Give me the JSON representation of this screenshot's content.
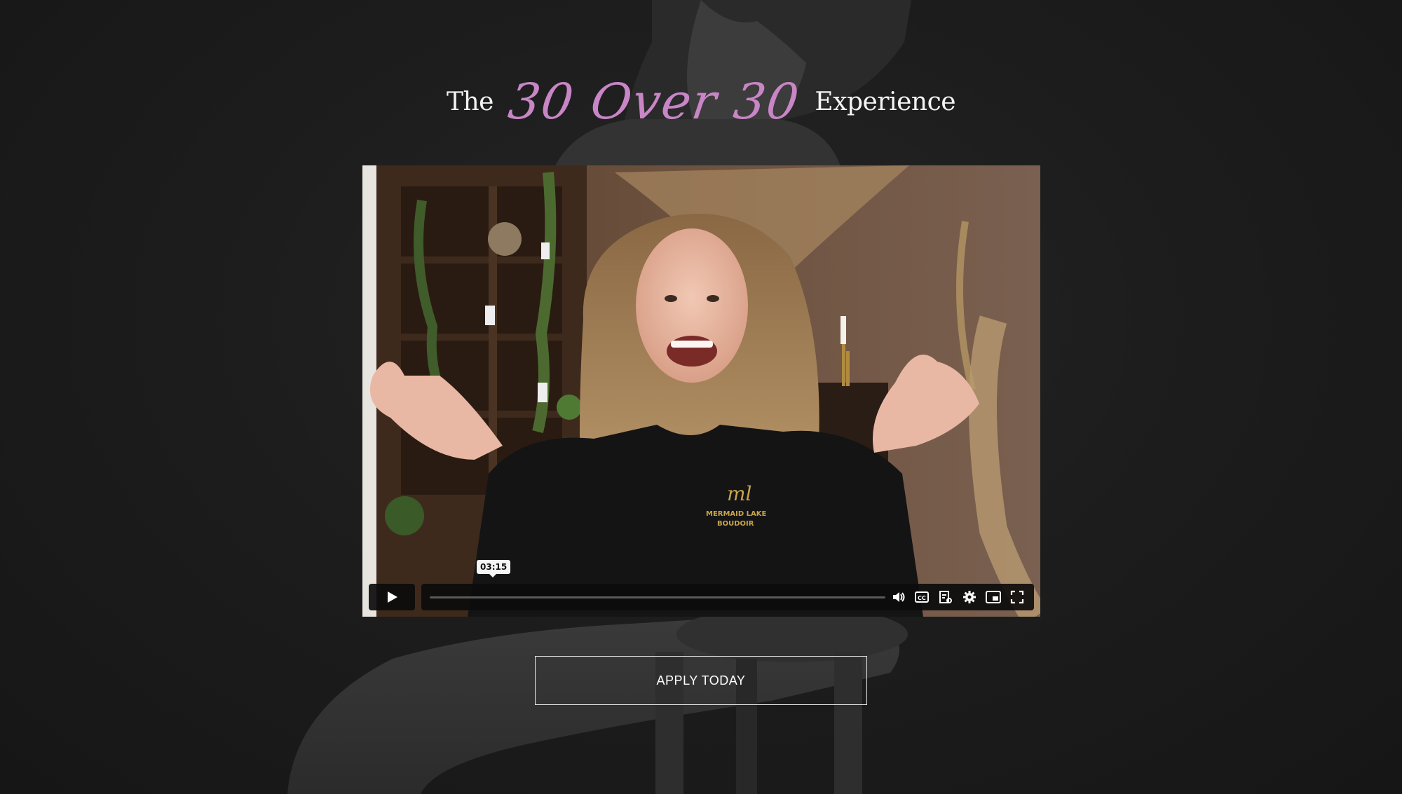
{
  "title": {
    "prefix": "The",
    "script": "30 Over 30",
    "suffix": "Experience"
  },
  "video": {
    "time_tooltip": "03:15",
    "progress": 0.0,
    "shirt_logo_mark": "ml",
    "shirt_logo_line1": "MERMAID LAKE",
    "shirt_logo_line2": "BOUDOIR",
    "controls": [
      "play-icon",
      "volume-icon",
      "captions-icon",
      "transcript-icon",
      "settings-icon",
      "pip-icon",
      "fullscreen-icon"
    ]
  },
  "cta": {
    "label": "APPLY TODAY"
  },
  "colors": {
    "background": "#1d1d1d",
    "script_accent": "#c886c6",
    "title_text": "#f3f3f3"
  }
}
